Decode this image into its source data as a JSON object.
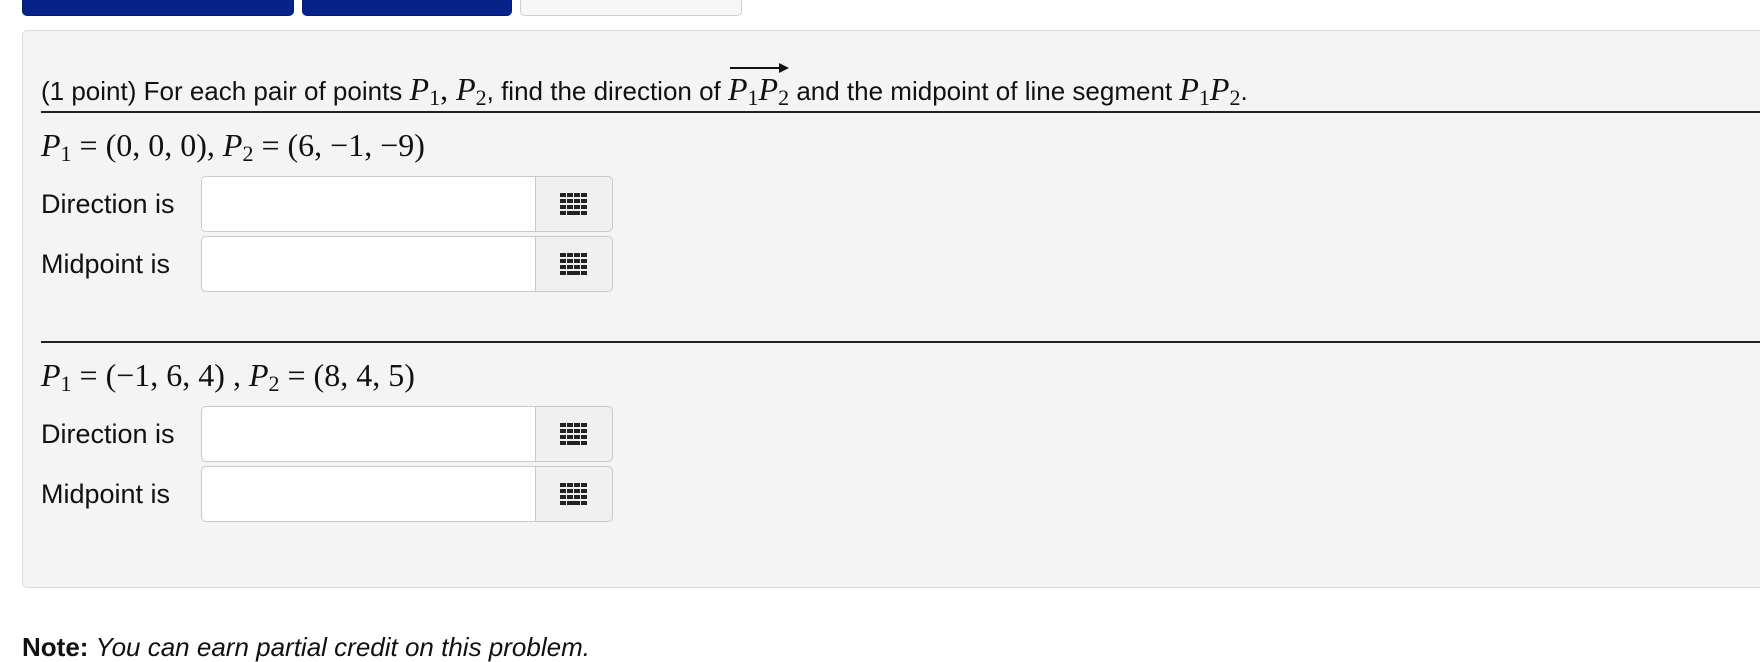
{
  "header_buttons": [
    {
      "label": ""
    },
    {
      "label": ""
    },
    {
      "label": ""
    }
  ],
  "problem": {
    "statement_prefix": "(1 point) For each pair of points",
    "statement_mid": ", find the direction of",
    "statement_mid2": "and the midpoint of line segment",
    "statement_end": ".",
    "p1": "P",
    "p2": "P",
    "sub1": "1",
    "sub2": "2",
    "comma": ",",
    "parts": [
      {
        "p1_value": "= (0, 0, 0),",
        "p2_value": "= (6, −1, −9)",
        "direction_label": "Direction is",
        "direction_value": "",
        "midpoint_label": "Midpoint is",
        "midpoint_value": ""
      },
      {
        "p1_value": "= (−1, 6, 4) ,",
        "p2_value": "= (8, 4, 5)",
        "direction_label": "Direction is",
        "direction_value": "",
        "midpoint_label": "Midpoint is",
        "midpoint_value": ""
      }
    ]
  },
  "note": {
    "label": "Note:",
    "text": "You can earn partial credit on this problem."
  },
  "icons": {
    "keypad": "keypad-icon"
  },
  "colors": {
    "primary_button": "#06238a",
    "panel_background": "#f4f4f4"
  }
}
